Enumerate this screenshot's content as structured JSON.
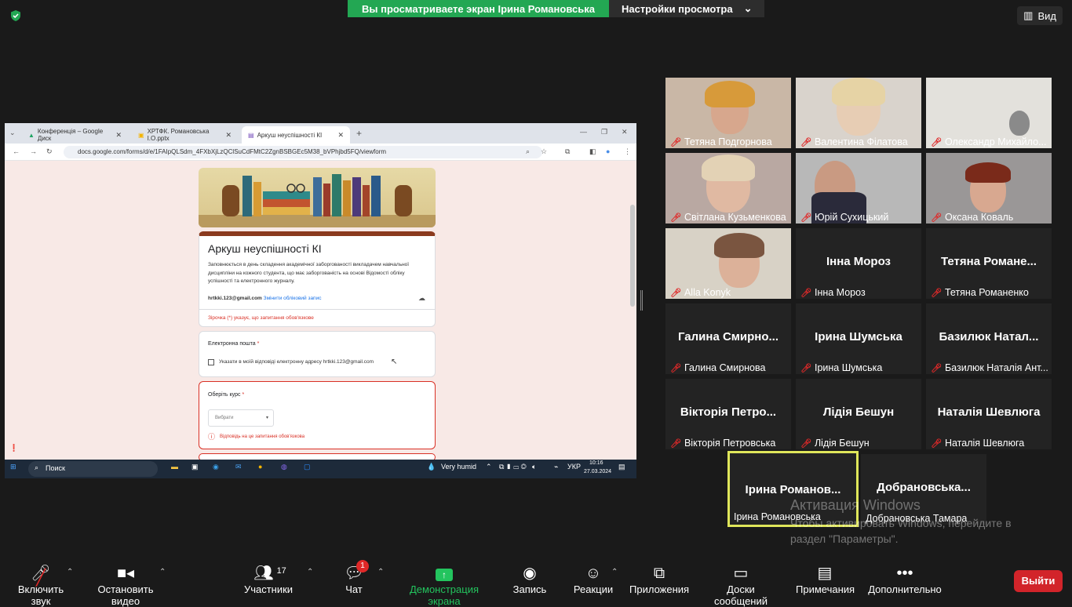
{
  "banner": {
    "sharing_text": "Вы просматриваете экран Ірина Романовська",
    "settings_label": "Настройки просмотра",
    "view_label": "Вид"
  },
  "browser": {
    "tabs": [
      {
        "label": "Конференція – Google Диск"
      },
      {
        "label": "ХРТФК. Романовська І.О.pptx"
      },
      {
        "label": "Аркуш неуспішності КІ"
      }
    ],
    "url": "docs.google.com/forms/d/e/1FAIpQLSdm_4FXbXjLzQClSuCdFMtC2ZgnBSBGEc5M38_bVPhjbd5FQ/viewform"
  },
  "form": {
    "title": "Аркуш неуспішності КІ",
    "description": "Заповнюється в день складення академічної заборгованості викладачем навчальної дисципліни на кожного студента, що має заборгованість на основі Відомості обліку успішності та електронного журналу.",
    "account_email": "hrtkki.123@gmail.com",
    "switch_account": "Змінити обліковий запис",
    "required_note": "Зірочка (*) указує, що запитання обов'язкове",
    "q1_label": "Електронна пошта",
    "q1_checkbox": "Указати в моїй відповіді електронну адресу hrtkki.123@gmail.com",
    "q2_label": "Оберіть курс",
    "q2_select_placeholder": "Вибрати",
    "q2_error": "Відповідь на це запитання обов'язкова",
    "required_star": "*"
  },
  "taskbar": {
    "search_label": "Поиск",
    "weather": "Very humid",
    "language": "УКР",
    "time": "10:16",
    "date": "27.03.2024",
    "notif_count": "2"
  },
  "participants": [
    {
      "name": "Тетяна Подгорнова",
      "video": true
    },
    {
      "name": "Валентина Філатова",
      "video": true
    },
    {
      "name": "Олександр Михайло...",
      "video": true
    },
    {
      "name": "Світлана Кузьменкова",
      "video": true
    },
    {
      "name": "Юрій Сухицький",
      "video": true
    },
    {
      "name": "Оксана Коваль",
      "video": true
    },
    {
      "name": "Alla Konyk",
      "video": true
    },
    {
      "name": "Інна Мороз",
      "display": "Інна Мороз",
      "video": false
    },
    {
      "name": "Тетяна Романенко",
      "display": "Тетяна Романе...",
      "video": false
    },
    {
      "name": "Галина Смирнова",
      "display": "Галина Смирно...",
      "video": false
    },
    {
      "name": "Ірина Шумська",
      "display": "Ірина Шумська",
      "video": false
    },
    {
      "name": "Базилюк Наталія Ант...",
      "display": "Базилюк Натал...",
      "video": false
    },
    {
      "name": "Вікторія Петровська",
      "display": "Вікторія Петро...",
      "video": false
    },
    {
      "name": "Лідія Бешун",
      "display": "Лідія Бешун",
      "video": false
    },
    {
      "name": "Наталія Шевлюга",
      "display": "Наталія Шевлюга",
      "video": false
    },
    {
      "name": "Ірина Романовська",
      "display": "Ірина Романов...",
      "video": false,
      "active": true
    },
    {
      "name": "Добрановська Тамара",
      "display": "Добрановська...",
      "video": false
    }
  ],
  "watermark": {
    "title": "Активация Windows",
    "line1": "Чтобы активировать Windows, перейдите в",
    "line2": "раздел \"Параметры\"."
  },
  "toolbar": {
    "unmute": "Включить звук",
    "stop_video": "Остановить видео",
    "participants": "Участники",
    "participants_count": "17",
    "chat": "Чат",
    "chat_badge": "1",
    "share": "Демонстрация экрана",
    "record": "Запись",
    "reactions": "Реакции",
    "apps": "Приложения",
    "whiteboards": "Доски сообщений",
    "notes": "Примечания",
    "more": "Дополнительно",
    "leave": "Выйти"
  },
  "colors": {
    "share_green": "#23a753",
    "leave_red": "#d2242a",
    "active_speaker": "#dfe65a",
    "muted_red": "#e02828",
    "form_header": "#8b3a1e"
  }
}
